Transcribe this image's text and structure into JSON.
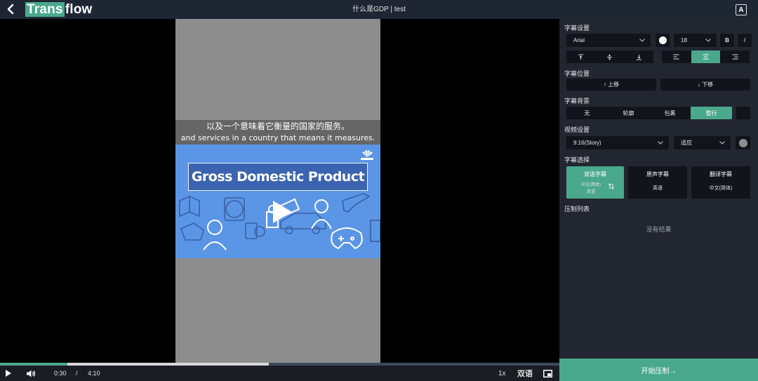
{
  "app": {
    "logo_part1": "Trans",
    "logo_part2": "flow",
    "title": "什么是GDP | test",
    "a_button": "A"
  },
  "video": {
    "subtitle_zh": "以及一个意味着它衡量的国家的服务。",
    "subtitle_en": "and services in a country that means it measures.",
    "thumbnail_title": "Gross Domestic Product",
    "progress_played": 0.12,
    "progress_buffered": 0.48
  },
  "controls": {
    "current_time": "0:30",
    "separator": "/",
    "duration": "4:10",
    "speed": "1x",
    "dual_label": "双语"
  },
  "panel": {
    "subtitle_settings": {
      "label": "字幕设置",
      "font": "Arial",
      "size": "18",
      "bold_label": "B",
      "italic_label": "I",
      "color": "#ffffff"
    },
    "subtitle_position": {
      "label": "字幕位置",
      "up": "↑ 上移",
      "down": "↓ 下移"
    },
    "subtitle_background": {
      "label": "字幕背景",
      "options": [
        "无",
        "轮廓",
        "包裹",
        "整行"
      ],
      "selected": 3
    },
    "video_settings": {
      "label": "视频设置",
      "ratio": "9:16(Story)",
      "fit": "适应"
    },
    "subtitle_select": {
      "label": "字幕选择",
      "cards": [
        {
          "title": "双语字幕",
          "line1": "中文(简体)",
          "line2": "英语"
        },
        {
          "title": "原声字幕",
          "line1": "英语"
        },
        {
          "title": "翻译字幕",
          "line1": "中文(简体)"
        }
      ]
    },
    "render_list": {
      "label": "压制列表",
      "empty": "没有结果"
    },
    "submit_label": "开始压制→"
  },
  "colors": {
    "accent": "#4aa98c",
    "topbar": "#1e2634",
    "panel": "#222631",
    "control_bg": "#11141a"
  }
}
